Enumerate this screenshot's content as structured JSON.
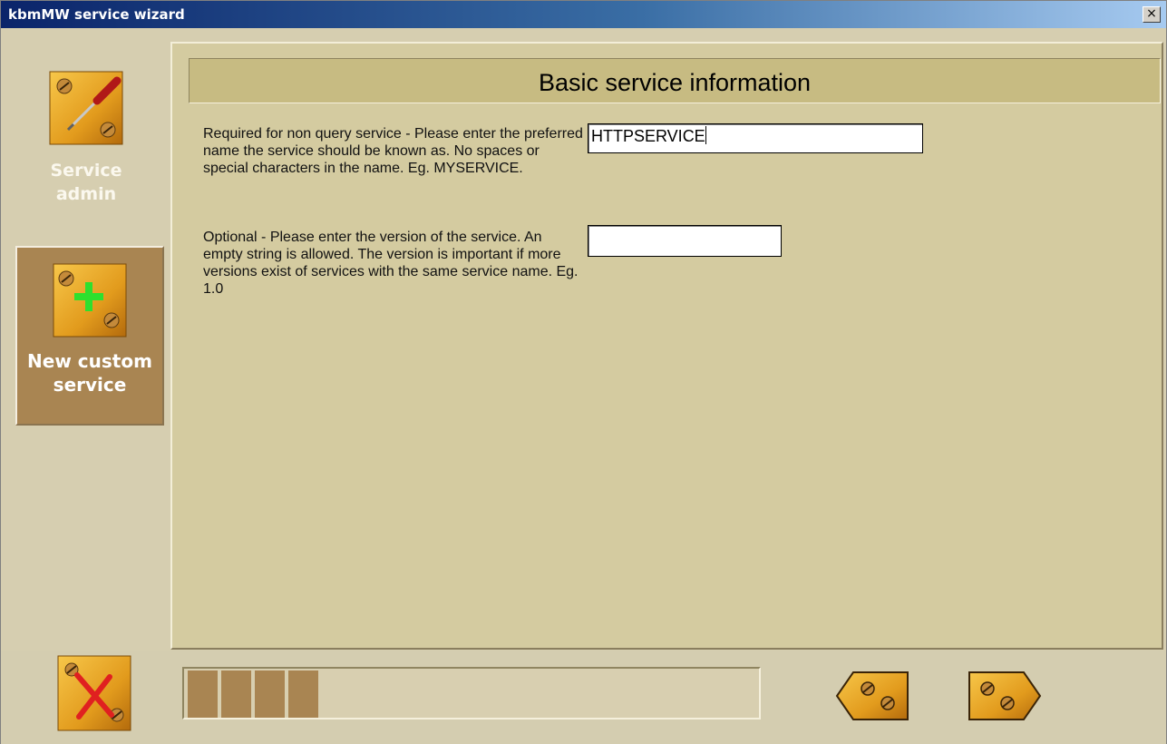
{
  "window": {
    "title": "kbmMW service wizard",
    "close_label": "×"
  },
  "nav": {
    "items": [
      {
        "label_line1": "Service",
        "label_line2": "admin",
        "icon": "screwdriver-icon",
        "selected": false
      },
      {
        "label_line1": "New custom",
        "label_line2": "service",
        "icon": "plus-icon",
        "selected": true
      }
    ]
  },
  "page": {
    "header": "Basic service information",
    "fields": [
      {
        "description": "Required for non query service - Please enter the preferred name the service should be known as. No spaces or special characters in the name. Eg. MYSERVICE.",
        "value": "HTTPSERVICE",
        "placeholder": ""
      },
      {
        "description": "Optional - Please enter the version of the service. An empty string is allowed. The version is important if more versions exist of services with the same service name. Eg. 1.0",
        "value": "",
        "placeholder": ""
      }
    ]
  },
  "footer": {
    "progress_filled_segments": 4,
    "cancel_icon": "cancel-icon",
    "back_icon": "back-arrow-icon",
    "next_icon": "next-arrow-icon"
  },
  "colors": {
    "accent": "#a98552",
    "panel": "#d4cba0",
    "header": "#c7bb82",
    "icon_gold": "#e0a020"
  }
}
